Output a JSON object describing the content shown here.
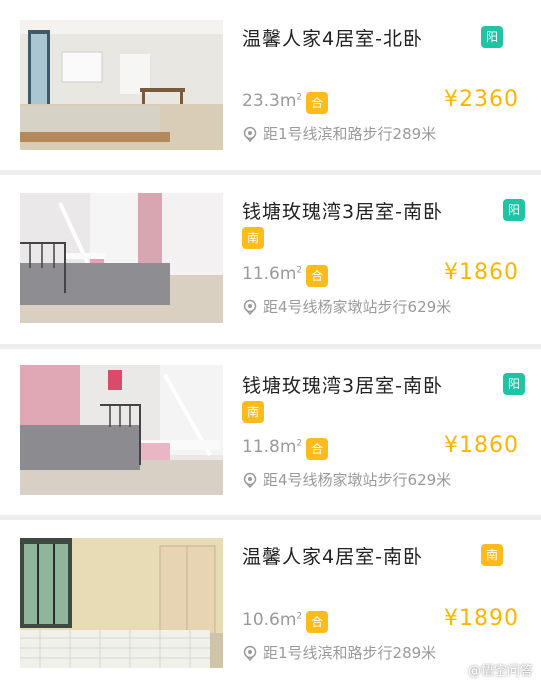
{
  "listings": [
    {
      "title": "温馨人家4居室-北卧",
      "tags": [
        "阳"
      ],
      "area": "23.3m",
      "area_sup": "2",
      "shared_tag": "合",
      "price": "¥2360",
      "location": "距1号线滨和路步行289米"
    },
    {
      "title": "钱塘玫瑰湾3居室-南卧",
      "tags": [
        "阳",
        "南"
      ],
      "area": "11.6m",
      "area_sup": "2",
      "shared_tag": "合",
      "price": "¥1860",
      "location": "距4号线杨家墩站步行629米"
    },
    {
      "title": "钱塘玫瑰湾3居室-南卧",
      "tags": [
        "阳",
        "南"
      ],
      "area": "11.8m",
      "area_sup": "2",
      "shared_tag": "合",
      "price": "¥1860",
      "location": "距4号线杨家墩站步行629米"
    },
    {
      "title": "温馨人家4居室-南卧",
      "tags": [
        "南"
      ],
      "area": "10.6m",
      "area_sup": "2",
      "shared_tag": "合",
      "price": "¥1890",
      "location": "距1号线滨和路步行289米"
    }
  ],
  "watermark": "@悟空问答",
  "colors": {
    "price": "#ffb400",
    "tag_green": "#20c3a4",
    "tag_yellow": "#ffbb1a",
    "muted_text": "#9a9a9a"
  }
}
